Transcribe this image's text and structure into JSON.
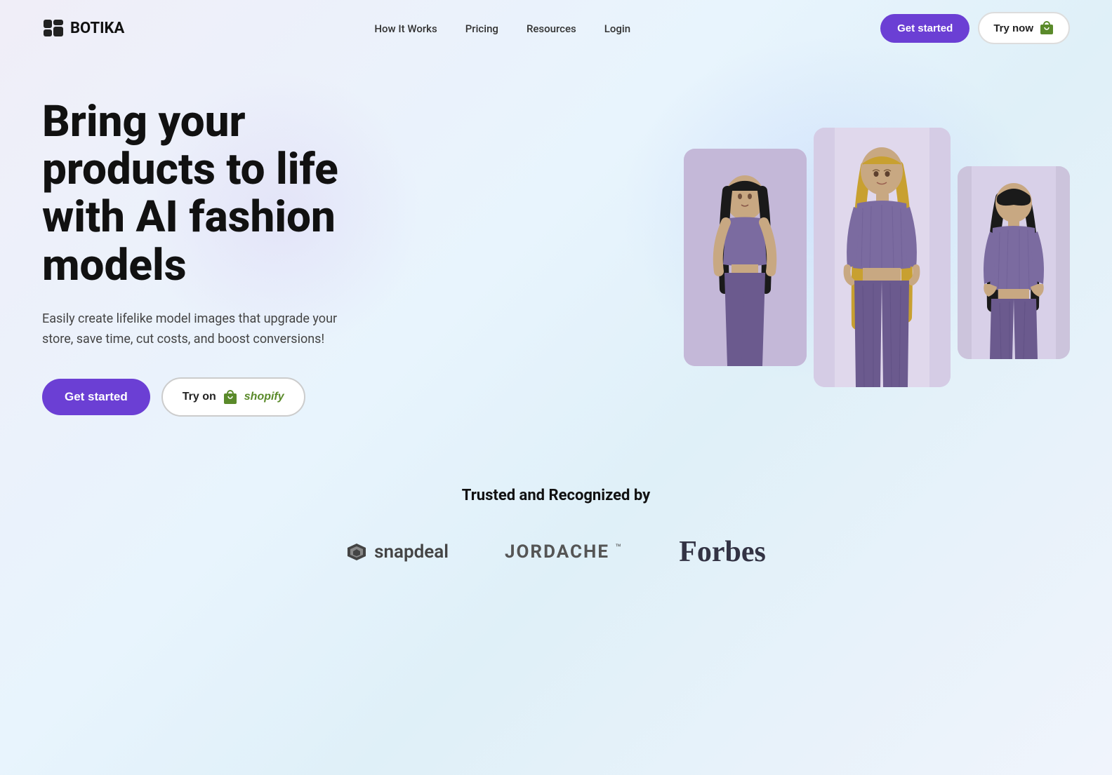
{
  "brand": {
    "name": "BOTIKA"
  },
  "nav": {
    "links": [
      {
        "label": "How It Works",
        "id": "how-it-works"
      },
      {
        "label": "Pricing",
        "id": "pricing"
      },
      {
        "label": "Resources",
        "id": "resources"
      },
      {
        "label": "Login",
        "id": "login"
      }
    ],
    "get_started_label": "Get started",
    "try_now_label": "Try now"
  },
  "hero": {
    "title": "Bring your products to life with AI fashion models",
    "subtitle": "Easily create lifelike model images that upgrade your store, save time, cut costs, and boost conversions!",
    "get_started_label": "Get started",
    "try_shopify_label": "Try on",
    "shopify_label": "shopify"
  },
  "trusted": {
    "title": "Trusted and Recognized by",
    "brands": [
      {
        "name": "snapdeal",
        "id": "snapdeal"
      },
      {
        "name": "JORDACHE",
        "id": "jordache"
      },
      {
        "name": "Forbes",
        "id": "forbes"
      }
    ]
  }
}
